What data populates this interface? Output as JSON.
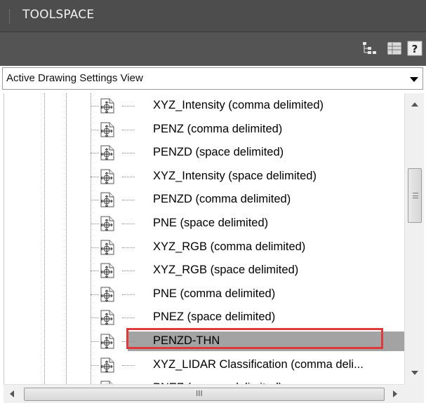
{
  "window": {
    "title": "TOOLSPACE"
  },
  "toolbar": {
    "icons": [
      "tree-structure-icon",
      "grid-panel-icon",
      "help-icon"
    ],
    "help_label": "?"
  },
  "view_selector": {
    "selected": "Active Drawing Settings View"
  },
  "tree": {
    "items": [
      {
        "label": "XYZ_Intensity (comma delimited)"
      },
      {
        "label": "PENZ (comma delimited)"
      },
      {
        "label": "PENZD (space delimited)"
      },
      {
        "label": "XYZ_Intensity (space delimited)"
      },
      {
        "label": "PENZD (comma delimited)"
      },
      {
        "label": "PNE (space delimited)"
      },
      {
        "label": "XYZ_RGB (comma delimited)"
      },
      {
        "label": "XYZ_RGB (space delimited)"
      },
      {
        "label": "PNE (comma delimited)"
      },
      {
        "label": "PNEZ (space delimited)"
      },
      {
        "label": "PENZD-THN",
        "selected": true
      },
      {
        "label": "XYZ_LIDAR Classification (comma deli..."
      },
      {
        "label": "PNEZ (comma delimited)"
      }
    ]
  },
  "colors": {
    "titlebar": "#4d4d4d",
    "toolbar": "#545454",
    "selection": "#a3a3a3",
    "highlight_box": "#e0393b"
  },
  "hscroll": {
    "grip_label": "III"
  }
}
